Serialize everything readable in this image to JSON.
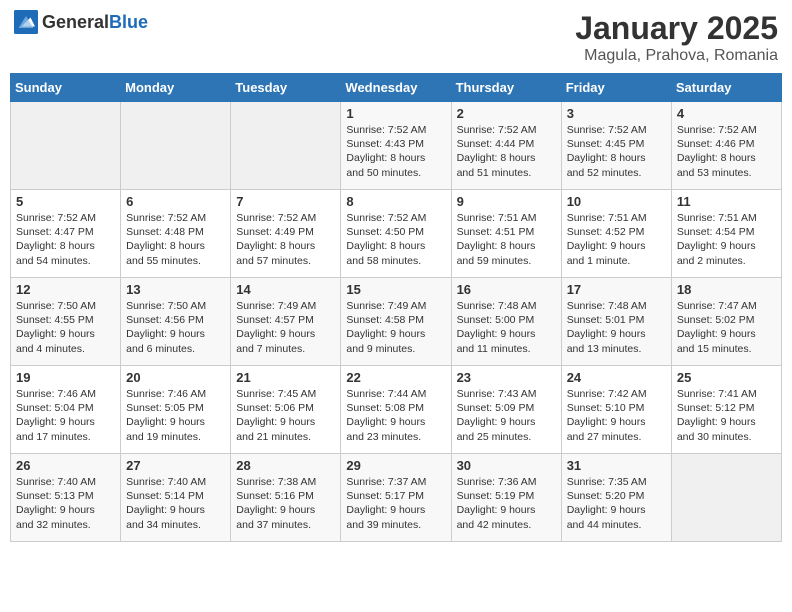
{
  "logo": {
    "text_general": "General",
    "text_blue": "Blue"
  },
  "calendar": {
    "title": "January 2025",
    "subtitle": "Magula, Prahova, Romania"
  },
  "weekdays": [
    "Sunday",
    "Monday",
    "Tuesday",
    "Wednesday",
    "Thursday",
    "Friday",
    "Saturday"
  ],
  "weeks": [
    [
      {
        "day": "",
        "sunrise": "",
        "sunset": "",
        "daylight": "",
        "empty": true
      },
      {
        "day": "",
        "sunrise": "",
        "sunset": "",
        "daylight": "",
        "empty": true
      },
      {
        "day": "",
        "sunrise": "",
        "sunset": "",
        "daylight": "",
        "empty": true
      },
      {
        "day": "1",
        "sunrise": "Sunrise: 7:52 AM",
        "sunset": "Sunset: 4:43 PM",
        "daylight": "Daylight: 8 hours and 50 minutes."
      },
      {
        "day": "2",
        "sunrise": "Sunrise: 7:52 AM",
        "sunset": "Sunset: 4:44 PM",
        "daylight": "Daylight: 8 hours and 51 minutes."
      },
      {
        "day": "3",
        "sunrise": "Sunrise: 7:52 AM",
        "sunset": "Sunset: 4:45 PM",
        "daylight": "Daylight: 8 hours and 52 minutes."
      },
      {
        "day": "4",
        "sunrise": "Sunrise: 7:52 AM",
        "sunset": "Sunset: 4:46 PM",
        "daylight": "Daylight: 8 hours and 53 minutes."
      }
    ],
    [
      {
        "day": "5",
        "sunrise": "Sunrise: 7:52 AM",
        "sunset": "Sunset: 4:47 PM",
        "daylight": "Daylight: 8 hours and 54 minutes."
      },
      {
        "day": "6",
        "sunrise": "Sunrise: 7:52 AM",
        "sunset": "Sunset: 4:48 PM",
        "daylight": "Daylight: 8 hours and 55 minutes."
      },
      {
        "day": "7",
        "sunrise": "Sunrise: 7:52 AM",
        "sunset": "Sunset: 4:49 PM",
        "daylight": "Daylight: 8 hours and 57 minutes."
      },
      {
        "day": "8",
        "sunrise": "Sunrise: 7:52 AM",
        "sunset": "Sunset: 4:50 PM",
        "daylight": "Daylight: 8 hours and 58 minutes."
      },
      {
        "day": "9",
        "sunrise": "Sunrise: 7:51 AM",
        "sunset": "Sunset: 4:51 PM",
        "daylight": "Daylight: 8 hours and 59 minutes."
      },
      {
        "day": "10",
        "sunrise": "Sunrise: 7:51 AM",
        "sunset": "Sunset: 4:52 PM",
        "daylight": "Daylight: 9 hours and 1 minute."
      },
      {
        "day": "11",
        "sunrise": "Sunrise: 7:51 AM",
        "sunset": "Sunset: 4:54 PM",
        "daylight": "Daylight: 9 hours and 2 minutes."
      }
    ],
    [
      {
        "day": "12",
        "sunrise": "Sunrise: 7:50 AM",
        "sunset": "Sunset: 4:55 PM",
        "daylight": "Daylight: 9 hours and 4 minutes."
      },
      {
        "day": "13",
        "sunrise": "Sunrise: 7:50 AM",
        "sunset": "Sunset: 4:56 PM",
        "daylight": "Daylight: 9 hours and 6 minutes."
      },
      {
        "day": "14",
        "sunrise": "Sunrise: 7:49 AM",
        "sunset": "Sunset: 4:57 PM",
        "daylight": "Daylight: 9 hours and 7 minutes."
      },
      {
        "day": "15",
        "sunrise": "Sunrise: 7:49 AM",
        "sunset": "Sunset: 4:58 PM",
        "daylight": "Daylight: 9 hours and 9 minutes."
      },
      {
        "day": "16",
        "sunrise": "Sunrise: 7:48 AM",
        "sunset": "Sunset: 5:00 PM",
        "daylight": "Daylight: 9 hours and 11 minutes."
      },
      {
        "day": "17",
        "sunrise": "Sunrise: 7:48 AM",
        "sunset": "Sunset: 5:01 PM",
        "daylight": "Daylight: 9 hours and 13 minutes."
      },
      {
        "day": "18",
        "sunrise": "Sunrise: 7:47 AM",
        "sunset": "Sunset: 5:02 PM",
        "daylight": "Daylight: 9 hours and 15 minutes."
      }
    ],
    [
      {
        "day": "19",
        "sunrise": "Sunrise: 7:46 AM",
        "sunset": "Sunset: 5:04 PM",
        "daylight": "Daylight: 9 hours and 17 minutes."
      },
      {
        "day": "20",
        "sunrise": "Sunrise: 7:46 AM",
        "sunset": "Sunset: 5:05 PM",
        "daylight": "Daylight: 9 hours and 19 minutes."
      },
      {
        "day": "21",
        "sunrise": "Sunrise: 7:45 AM",
        "sunset": "Sunset: 5:06 PM",
        "daylight": "Daylight: 9 hours and 21 minutes."
      },
      {
        "day": "22",
        "sunrise": "Sunrise: 7:44 AM",
        "sunset": "Sunset: 5:08 PM",
        "daylight": "Daylight: 9 hours and 23 minutes."
      },
      {
        "day": "23",
        "sunrise": "Sunrise: 7:43 AM",
        "sunset": "Sunset: 5:09 PM",
        "daylight": "Daylight: 9 hours and 25 minutes."
      },
      {
        "day": "24",
        "sunrise": "Sunrise: 7:42 AM",
        "sunset": "Sunset: 5:10 PM",
        "daylight": "Daylight: 9 hours and 27 minutes."
      },
      {
        "day": "25",
        "sunrise": "Sunrise: 7:41 AM",
        "sunset": "Sunset: 5:12 PM",
        "daylight": "Daylight: 9 hours and 30 minutes."
      }
    ],
    [
      {
        "day": "26",
        "sunrise": "Sunrise: 7:40 AM",
        "sunset": "Sunset: 5:13 PM",
        "daylight": "Daylight: 9 hours and 32 minutes."
      },
      {
        "day": "27",
        "sunrise": "Sunrise: 7:40 AM",
        "sunset": "Sunset: 5:14 PM",
        "daylight": "Daylight: 9 hours and 34 minutes."
      },
      {
        "day": "28",
        "sunrise": "Sunrise: 7:38 AM",
        "sunset": "Sunset: 5:16 PM",
        "daylight": "Daylight: 9 hours and 37 minutes."
      },
      {
        "day": "29",
        "sunrise": "Sunrise: 7:37 AM",
        "sunset": "Sunset: 5:17 PM",
        "daylight": "Daylight: 9 hours and 39 minutes."
      },
      {
        "day": "30",
        "sunrise": "Sunrise: 7:36 AM",
        "sunset": "Sunset: 5:19 PM",
        "daylight": "Daylight: 9 hours and 42 minutes."
      },
      {
        "day": "31",
        "sunrise": "Sunrise: 7:35 AM",
        "sunset": "Sunset: 5:20 PM",
        "daylight": "Daylight: 9 hours and 44 minutes."
      },
      {
        "day": "",
        "sunrise": "",
        "sunset": "",
        "daylight": "",
        "empty": true
      }
    ]
  ]
}
